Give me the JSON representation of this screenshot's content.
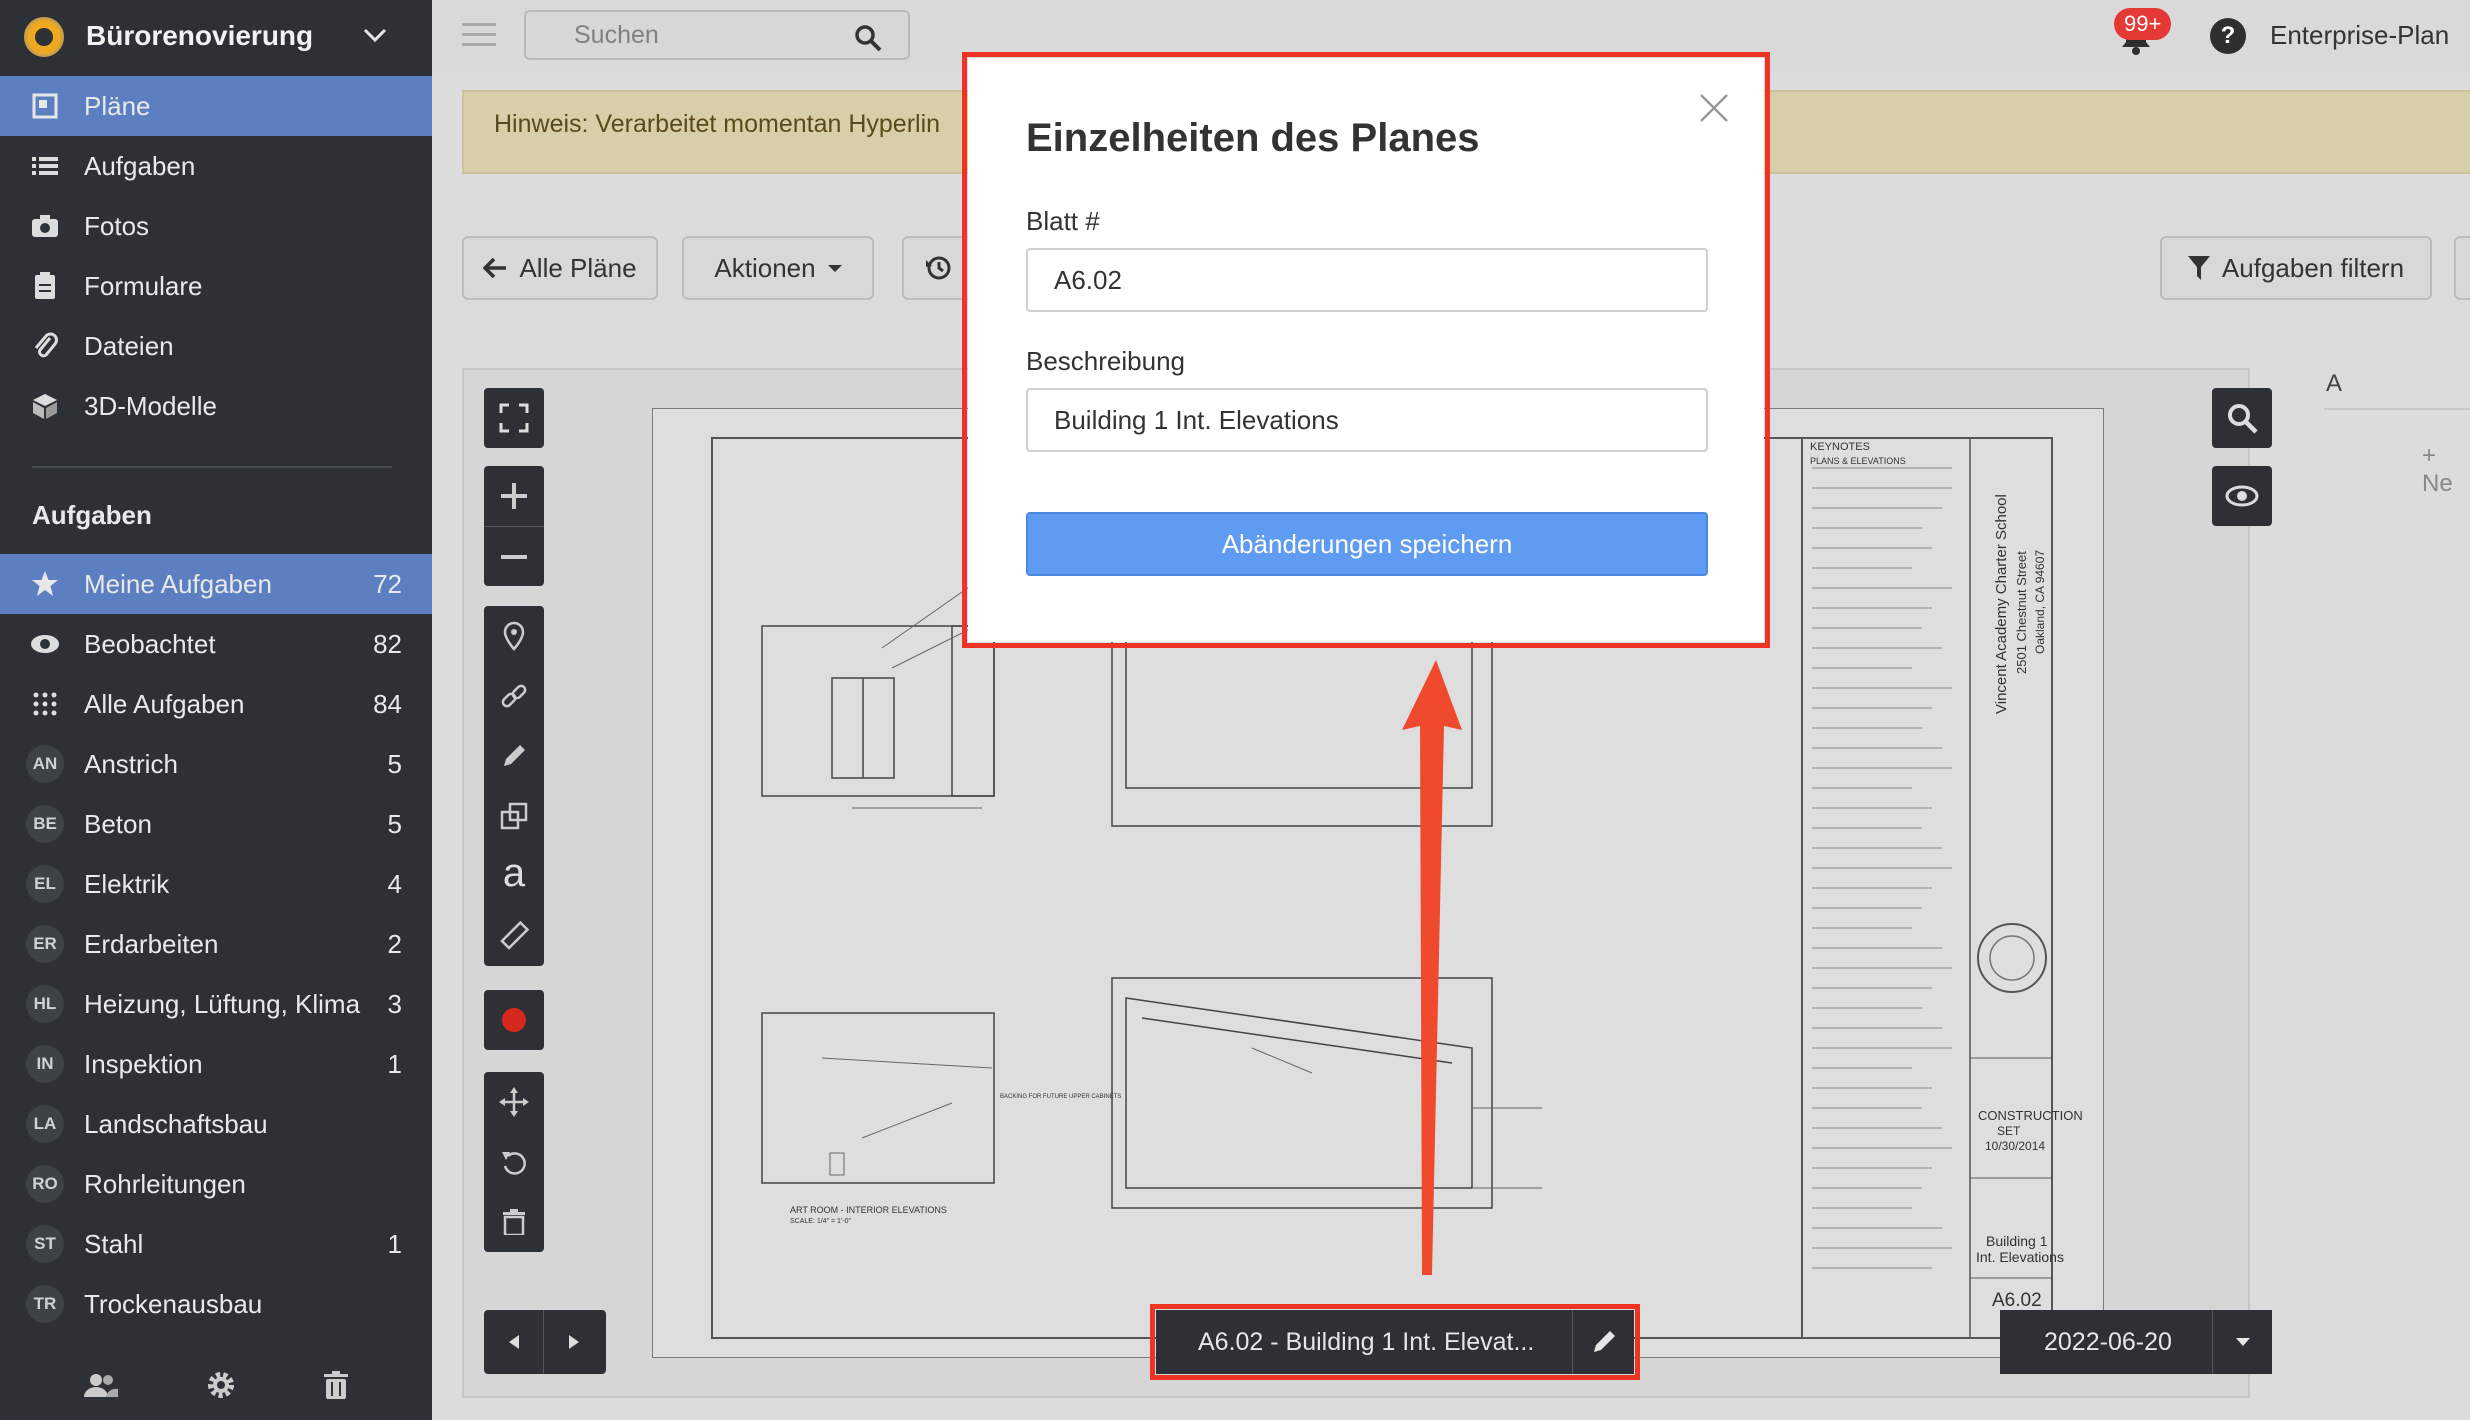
{
  "sidebar": {
    "project_name": "Bürorenovierung",
    "nav": [
      {
        "label": "Pläne",
        "icon": "plans-icon"
      },
      {
        "label": "Aufgaben",
        "icon": "list-icon"
      },
      {
        "label": "Fotos",
        "icon": "camera-icon"
      },
      {
        "label": "Formulare",
        "icon": "clipboard-icon"
      },
      {
        "label": "Dateien",
        "icon": "paperclip-icon"
      },
      {
        "label": "3D-Modelle",
        "icon": "cube-icon"
      }
    ],
    "tasks_heading": "Aufgaben",
    "task_items": [
      {
        "label": "Meine Aufgaben",
        "count": "72",
        "icon": "star-icon"
      },
      {
        "label": "Beobachtet",
        "count": "82",
        "icon": "eye-icon"
      },
      {
        "label": "Alle Aufgaben",
        "count": "84",
        "icon": "grid-icon"
      },
      {
        "abbr": "AN",
        "label": "Anstrich",
        "count": "5"
      },
      {
        "abbr": "BE",
        "label": "Beton",
        "count": "5"
      },
      {
        "abbr": "EL",
        "label": "Elektrik",
        "count": "4"
      },
      {
        "abbr": "ER",
        "label": "Erdarbeiten",
        "count": "2"
      },
      {
        "abbr": "HL",
        "label": "Heizung, Lüftung, Klima",
        "count": "3"
      },
      {
        "abbr": "IN",
        "label": "Inspektion",
        "count": "1"
      },
      {
        "abbr": "LA",
        "label": "Landschaftsbau",
        "count": ""
      },
      {
        "abbr": "RO",
        "label": "Rohrleitungen",
        "count": ""
      },
      {
        "abbr": "ST",
        "label": "Stahl",
        "count": "1"
      },
      {
        "abbr": "TR",
        "label": "Trockenausbau",
        "count": ""
      }
    ]
  },
  "topbar": {
    "search_placeholder": "Suchen",
    "notifications": "99+",
    "help": "?",
    "plan_label": "Enterprise-Plan"
  },
  "hint": "Hinweis: Verarbeitet momentan Hyperlin",
  "toolbar": {
    "all_plans": "Alle Pläne",
    "actions": "Aktionen",
    "filter_tasks": "Aufgaben filtern"
  },
  "right_panel": {
    "partial_a": "A",
    "partial_new": "+ Ne"
  },
  "bottom": {
    "sheet_label": "A6.02 - Building 1 Int. Elevat...",
    "date": "2022-06-20"
  },
  "drawing": {
    "keynotes": "KEYNOTES",
    "plans_elevations": "PLANS & ELEVATIONS",
    "school": "Vincent Academy Charter School",
    "address1": "2501 Chestnut Street",
    "address2": "Oakland, CA 94607",
    "construction": "CONSTRUCTION",
    "set": "SET",
    "set_date": "10/30/2014",
    "title1": "Building 1",
    "title2": "Int. Elevations",
    "sheet_no": "A6.02",
    "view_title": "ART ROOM - INTERIOR ELEVATIONS",
    "scale": "SCALE: 1/4\" = 1'-0\"",
    "backing_note": "BACKING FOR FUTURE UPPER CABINETS"
  },
  "modal": {
    "title": "Einzelheiten des Planes",
    "sheet_label": "Blatt #",
    "sheet_value": "A6.02",
    "desc_label": "Beschreibung",
    "desc_value": "Building 1 Int. Elevations",
    "save": "Abänderungen speichern"
  },
  "colors": {
    "sidebar_bg": "#2d3135",
    "active": "#5b7fc0",
    "highlight": "#ee3424",
    "primary_button": "#5f9cf1"
  }
}
